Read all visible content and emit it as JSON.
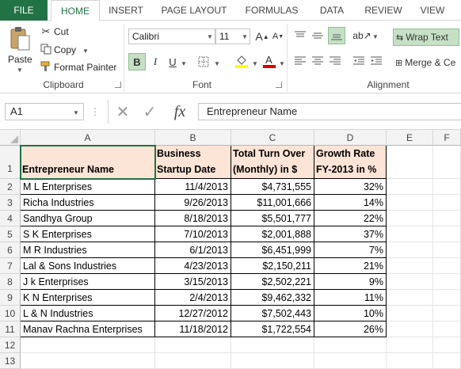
{
  "ribbon_tabs": [
    "FILE",
    "HOME",
    "INSERT",
    "PAGE LAYOUT",
    "FORMULAS",
    "DATA",
    "REVIEW",
    "VIEW"
  ],
  "active_tab": "HOME",
  "clipboard": {
    "paste": "Paste",
    "cut": "Cut",
    "copy": "Copy",
    "format_painter": "Format Painter",
    "label": "Clipboard"
  },
  "font": {
    "name": "Calibri",
    "size": "11",
    "bold": "B",
    "italic": "I",
    "underline": "U",
    "label": "Font"
  },
  "alignment": {
    "wrap_text": "Wrap Text",
    "merge_center": "Merge & Ce",
    "label": "Alignment"
  },
  "formula_bar": {
    "name_box": "A1",
    "fx": "fx",
    "content": "Entrepreneur Name"
  },
  "columns": [
    "A",
    "B",
    "C",
    "D",
    "E",
    "F"
  ],
  "rows": [
    "1",
    "2",
    "3",
    "4",
    "5",
    "6",
    "7",
    "8",
    "9",
    "10",
    "11",
    "12",
    "13"
  ],
  "table": {
    "headers": [
      [
        "Entrepreneur Name"
      ],
      [
        "Business",
        "Startup Date"
      ],
      [
        "Total Turn Over",
        "(Monthly) in $"
      ],
      [
        "Growth Rate",
        "FY-2013 in %"
      ]
    ],
    "data": [
      [
        "M L Enterprises",
        "11/4/2013",
        "$4,731,555",
        "32%"
      ],
      [
        "Richa Industries",
        "9/26/2013",
        "$11,001,666",
        "14%"
      ],
      [
        "Sandhya Group",
        "8/18/2013",
        "$5,501,777",
        "22%"
      ],
      [
        "S K Enterprises",
        "7/10/2013",
        "$2,001,888",
        "37%"
      ],
      [
        "M R Industries",
        "6/1/2013",
        "$6,451,999",
        "7%"
      ],
      [
        "Lal & Sons Industries",
        "4/23/2013",
        "$2,150,211",
        "21%"
      ],
      [
        "J k Enterprises",
        "3/15/2013",
        "$2,502,221",
        "9%"
      ],
      [
        "K N Enterprises",
        "2/4/2013",
        "$9,462,332",
        "11%"
      ],
      [
        "L & N Industries",
        "12/27/2012",
        "$7,502,443",
        "10%"
      ],
      [
        "Manav Rachna Enterprises",
        "11/18/2012",
        "$1,722,554",
        "26%"
      ]
    ]
  },
  "colors": {
    "excel_green": "#217346",
    "header_fill": "#fce4d6",
    "font_color_red": "#e00000",
    "highlight_yellow": "#ffff00"
  }
}
